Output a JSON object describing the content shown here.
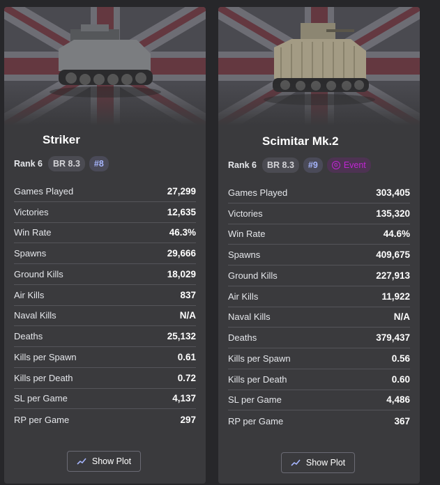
{
  "cards": [
    {
      "name": "Striker",
      "rank": "Rank 6",
      "br": "BR 8.3",
      "position": "#8",
      "event": null,
      "stats": [
        {
          "label": "Games Played",
          "value": "27,299"
        },
        {
          "label": "Victories",
          "value": "12,635"
        },
        {
          "label": "Win Rate",
          "value": "46.3%"
        },
        {
          "label": "Spawns",
          "value": "29,666"
        },
        {
          "label": "Ground Kills",
          "value": "18,029"
        },
        {
          "label": "Air Kills",
          "value": "837"
        },
        {
          "label": "Naval Kills",
          "value": "N/A"
        },
        {
          "label": "Deaths",
          "value": "25,132"
        },
        {
          "label": "Kills per Spawn",
          "value": "0.61"
        },
        {
          "label": "Kills per Death",
          "value": "0.72"
        },
        {
          "label": "SL per Game",
          "value": "4,137"
        },
        {
          "label": "RP per Game",
          "value": "297"
        }
      ],
      "button_label": "Show Plot",
      "flag_icon": "union-jack",
      "vehicle_icon": "tank-image"
    },
    {
      "name": "Scimitar Mk.2",
      "rank": "Rank 6",
      "br": "BR 8.3",
      "position": "#9",
      "event": "Event",
      "stats": [
        {
          "label": "Games Played",
          "value": "303,405"
        },
        {
          "label": "Victories",
          "value": "135,320"
        },
        {
          "label": "Win Rate",
          "value": "44.6%"
        },
        {
          "label": "Spawns",
          "value": "409,675"
        },
        {
          "label": "Ground Kills",
          "value": "227,913"
        },
        {
          "label": "Air Kills",
          "value": "11,922"
        },
        {
          "label": "Naval Kills",
          "value": "N/A"
        },
        {
          "label": "Deaths",
          "value": "379,437"
        },
        {
          "label": "Kills per Spawn",
          "value": "0.56"
        },
        {
          "label": "Kills per Death",
          "value": "0.60"
        },
        {
          "label": "SL per Game",
          "value": "4,486"
        },
        {
          "label": "RP per Game",
          "value": "367"
        }
      ],
      "button_label": "Show Plot",
      "flag_icon": "union-jack",
      "vehicle_icon": "tank-image"
    }
  ],
  "colors": {
    "background": "#27272a",
    "card": "#3a3a3d",
    "position_badge_text": "#a5b4fc",
    "event_accent": "#c026d3"
  }
}
